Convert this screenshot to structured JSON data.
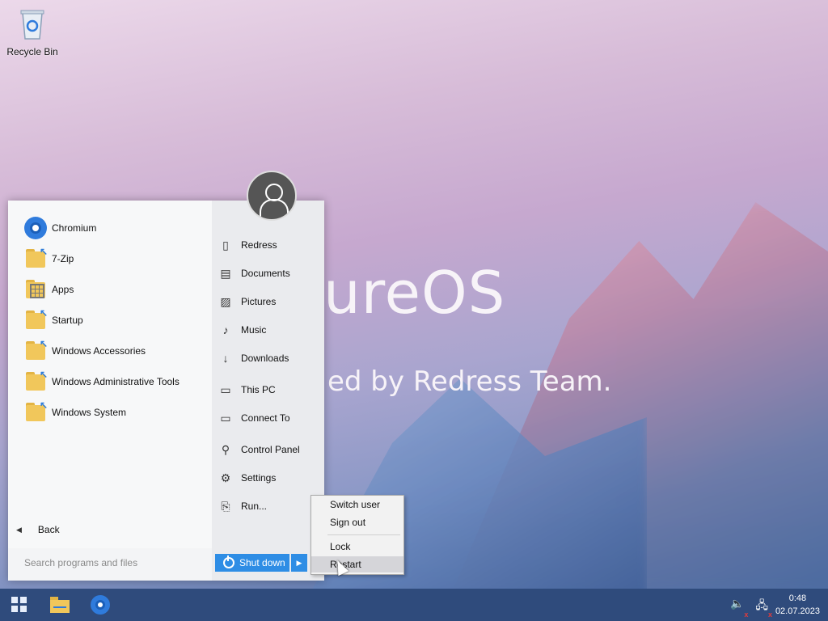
{
  "desktop": {
    "icons": [
      {
        "label": "Recycle Bin",
        "icon": "recycle-bin-icon"
      }
    ]
  },
  "wallpaper": {
    "title": "ureOS",
    "subtitle": "ed by Redress Team."
  },
  "start_menu": {
    "apps": [
      {
        "label": "Chromium",
        "icon": "chromium-icon"
      },
      {
        "label": "7-Zip",
        "icon": "folder-shortcut-icon"
      },
      {
        "label": "Apps",
        "icon": "apps-grid-icon"
      },
      {
        "label": "Startup",
        "icon": "folder-shortcut-icon"
      },
      {
        "label": "Windows Accessories",
        "icon": "folder-shortcut-icon"
      },
      {
        "label": "Windows Administrative Tools",
        "icon": "folder-shortcut-icon"
      },
      {
        "label": "Windows System",
        "icon": "folder-shortcut-icon"
      }
    ],
    "back_label": "Back",
    "search_placeholder": "Search programs and files",
    "places": [
      {
        "label": "Redress",
        "icon": "user-folder-icon"
      },
      {
        "label": "Documents",
        "icon": "document-icon"
      },
      {
        "label": "Pictures",
        "icon": "picture-icon"
      },
      {
        "label": "Music",
        "icon": "music-note-icon"
      },
      {
        "label": "Downloads",
        "icon": "download-arrow-icon"
      },
      {
        "label": "This PC",
        "icon": "monitor-icon"
      },
      {
        "label": "Connect To",
        "icon": "network-icon"
      },
      {
        "label": "Control Panel",
        "icon": "wrench-icon"
      },
      {
        "label": "Settings",
        "icon": "gear-icon"
      },
      {
        "label": "Run...",
        "icon": "run-icon"
      }
    ],
    "shutdown_label": "Shut down"
  },
  "power_menu": {
    "items": [
      "Switch user",
      "Sign out",
      "Lock",
      "Restart"
    ],
    "highlighted": "Restart"
  },
  "taskbar": {
    "pinned": [
      "start-icon",
      "file-explorer-icon",
      "chromium-icon"
    ],
    "tray": [
      "volume-muted-icon",
      "network-disconnected-icon"
    ],
    "time": "0:48",
    "date": "02.07.2023"
  }
}
